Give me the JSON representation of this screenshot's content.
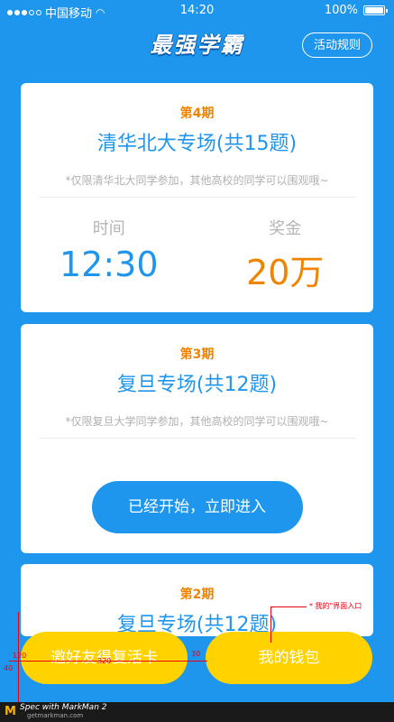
{
  "status_bar": {
    "carrier": "中国移动",
    "time": "14:20",
    "battery": "100%"
  },
  "header": {
    "title": "最强学霸",
    "rules_button": "活动规则"
  },
  "cards": [
    {
      "period": "第4期",
      "title": "清华北大专场(共15题)",
      "note": "*仅限清华北大同学参加，其他高校的同学可以围观哦~",
      "time_label": "时间",
      "time_value": "12:30",
      "prize_label": "奖金",
      "prize_value": "20万"
    },
    {
      "period": "第3期",
      "title": "复旦专场(共12题)",
      "note": "*仅限复旦大学同学参加，其他高校的同学可以围观哦~",
      "button": "已经开始，立即进入"
    },
    {
      "period": "第2期",
      "title": "复旦专场(共12题)"
    }
  ],
  "bottom": {
    "invite_button": "邀好友得复活卡",
    "wallet_button": "我的钱包"
  },
  "annotations": {
    "wallet_entry": "* 我的\"界面入口",
    "gap": "30",
    "width": "320",
    "height": "120",
    "side": "40"
  },
  "footer": {
    "spec": "Spec with MarkMan 2",
    "site": "getmarkman.com"
  }
}
